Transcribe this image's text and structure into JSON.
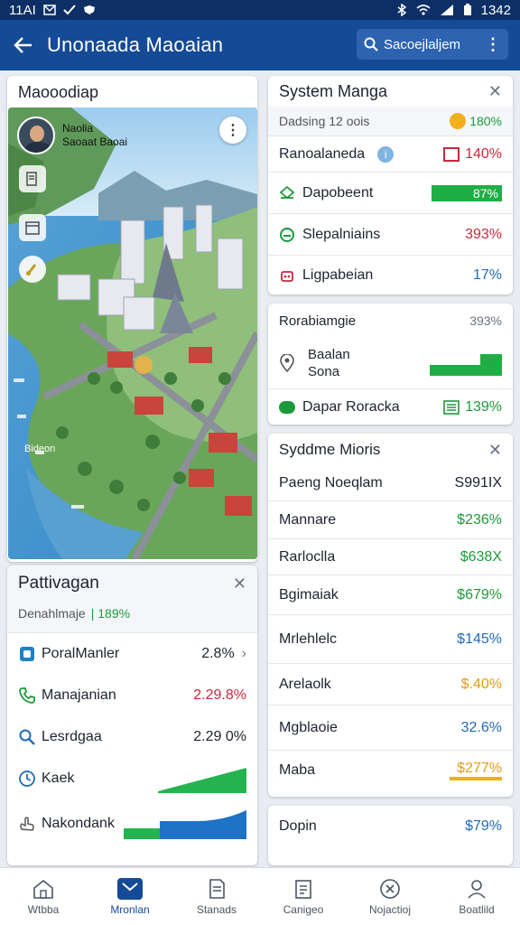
{
  "status": {
    "left": "11AI",
    "time": "1342"
  },
  "appbar": {
    "title": "Unonaada Maoaian",
    "search_label": "Sacoejlaljem"
  },
  "map_card": {
    "title": "Maooodiap",
    "profile_line1": "Naolia",
    "profile_line2": "Saoaat Baoai",
    "map_label": "Bideon"
  },
  "pattern_card": {
    "title": "Pattivagan",
    "subtitle": "Denahlmaje",
    "subtitle_value": "| 189%",
    "rows": [
      {
        "label": "PoralManler",
        "value": "2.8%",
        "value_color": "#1d2330",
        "icon": "square-icon"
      },
      {
        "label": "Manajanian",
        "value": "2.29.8%",
        "value_color": "#c8283b",
        "icon": "phone-icon"
      },
      {
        "label": "Lesrdgaa",
        "value": "2.29 0%",
        "value_color": "#1d2330",
        "icon": "search-icon"
      },
      {
        "label": "Kaek",
        "value": "",
        "icon": "clock-icon"
      },
      {
        "label": "Nakondank",
        "value": "",
        "icon": "hand-icon"
      }
    ]
  },
  "system_card": {
    "title": "System Manga",
    "subtitle": "Dadsing 12 oois",
    "badge_value": "180%",
    "rows": [
      {
        "label": "Ranoalaneda",
        "value": "140%",
        "color": "#c8283b"
      },
      {
        "label": "Dapobeent",
        "value": "87%",
        "color": "#1c9a3a"
      },
      {
        "label": "Slepalniains",
        "value": "393%",
        "color": "#c8283b"
      },
      {
        "label": "Ligpabeian",
        "value": "17%",
        "color": "#1f6bb8"
      }
    ]
  },
  "stats_card": {
    "title": "Rorabiamgie",
    "title_value": "393%",
    "row1_line1": "Baalan",
    "row1_line2": "Sona",
    "row2_label": "Dapar Roracka",
    "row2_value": "139%"
  },
  "metrics_card": {
    "title": "Syddme Mioris",
    "rows": [
      {
        "label": "Paeng Noeqlam",
        "value": "S991IX",
        "color": "#1d2330"
      },
      {
        "label": "Mannare",
        "value": "$236%",
        "color": "#1c9a3a"
      },
      {
        "label": "Rarloclla",
        "value": "$638X",
        "color": "#1c9a3a"
      },
      {
        "label": "Bgimaiak",
        "value": "$679%",
        "color": "#1c9a3a"
      },
      {
        "label": "Mrlehlelc",
        "value": "$145%",
        "color": "#1f6bb8"
      },
      {
        "label": "Arelaolk",
        "value": "$.40%",
        "color": "#e39c12"
      },
      {
        "label": "Mgblaoie",
        "value": "32.6%",
        "color": "#1f6bb8"
      },
      {
        "label": "Maba",
        "value": "$277%",
        "color": "#e39c12"
      }
    ]
  },
  "extra_card": {
    "label": "Dopin",
    "value": "$79%",
    "color": "#1f6bb8"
  },
  "navbar": {
    "items": [
      {
        "label": "Wtbba",
        "icon": "home-icon"
      },
      {
        "label": "Mronlan",
        "icon": "mail-icon"
      },
      {
        "label": "Stanads",
        "icon": "document-icon"
      },
      {
        "label": "Canigeo",
        "icon": "clipboard-icon"
      },
      {
        "label": "Nojactioj",
        "icon": "x-circle-icon"
      },
      {
        "label": "Boatlild",
        "icon": "user-icon"
      }
    ]
  }
}
